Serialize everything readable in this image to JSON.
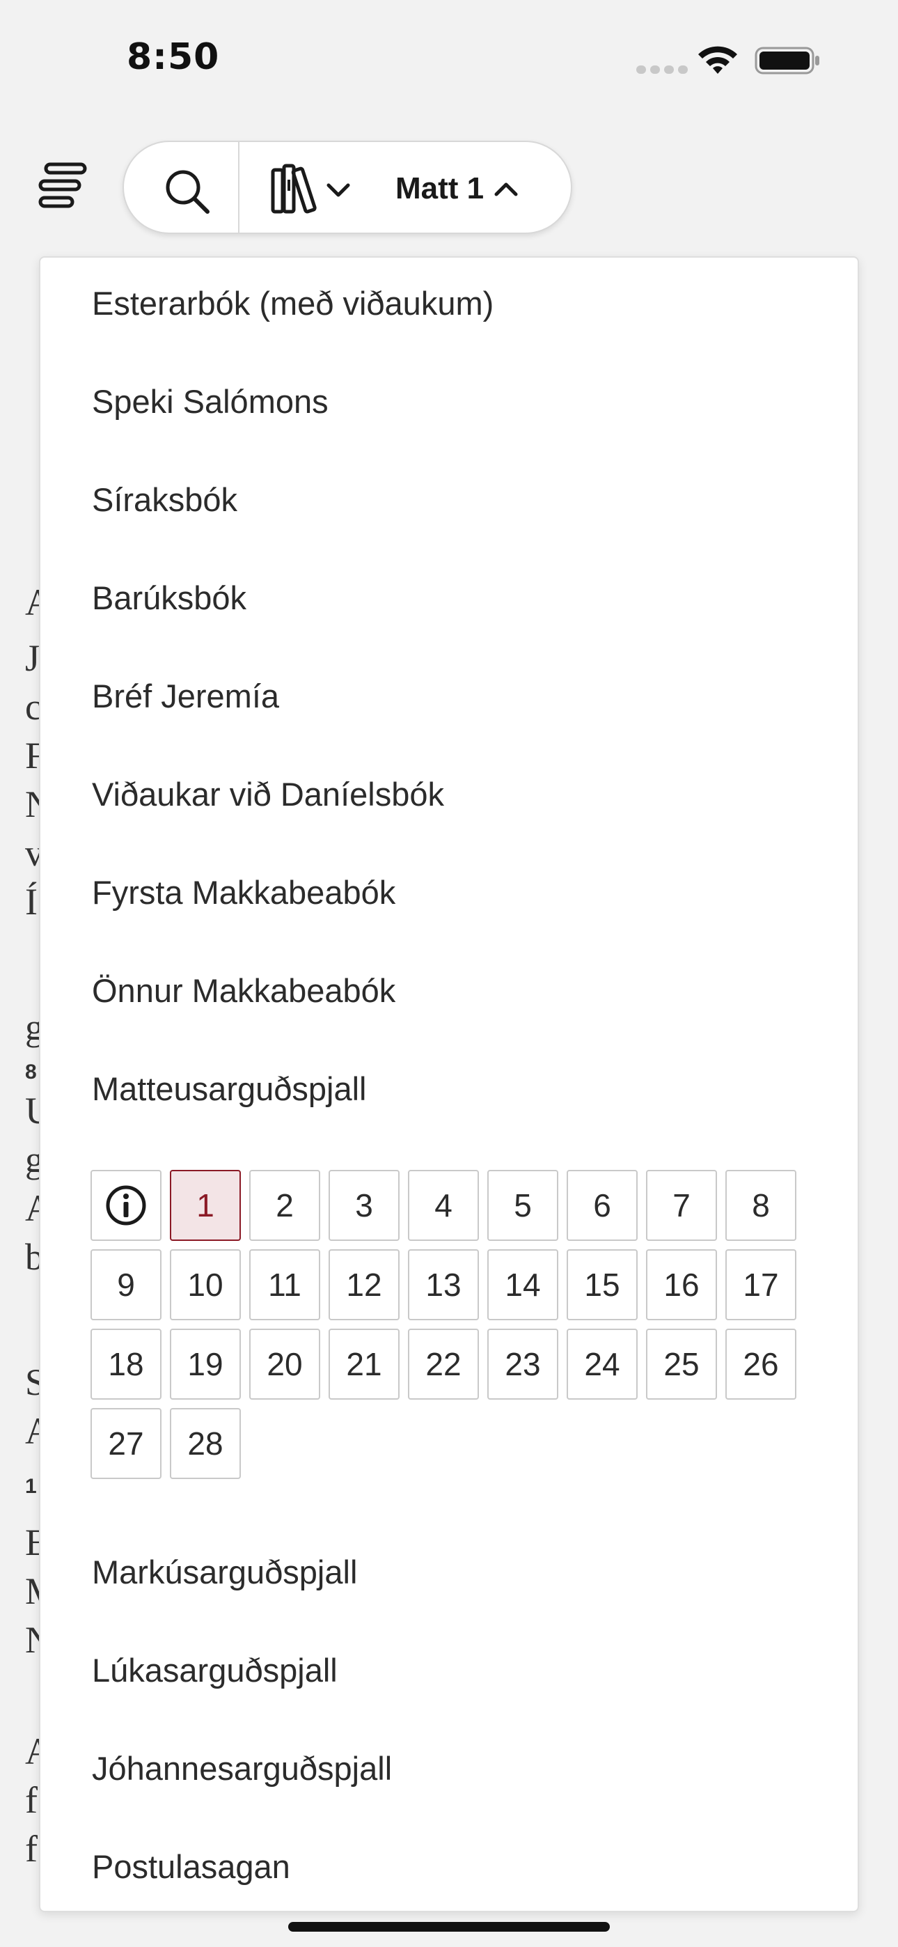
{
  "status_bar": {
    "time": "8:50"
  },
  "toolbar": {
    "chapter_label": "Matt 1",
    "menu_icon": "menu-lines-icon",
    "search_icon": "search-icon",
    "library_icon": "library-books-icon"
  },
  "dropdown": {
    "books_before": [
      "Esterarbók (með viðaukum)",
      "Speki Salómons",
      "Síraksbók",
      "Barúksbók",
      "Bréf Jeremía",
      "Viðaukar við Daníelsbók",
      "Fyrsta Makkabeabók",
      "Önnur Makkabeabók",
      "Matteusarguðspjall"
    ],
    "chapters": [
      "1",
      "2",
      "3",
      "4",
      "5",
      "6",
      "7",
      "8",
      "9",
      "10",
      "11",
      "12",
      "13",
      "14",
      "15",
      "16",
      "17",
      "18",
      "19",
      "20",
      "21",
      "22",
      "23",
      "24",
      "25",
      "26",
      "27",
      "28"
    ],
    "selected_chapter": "1",
    "books_after": [
      "Markúsarguðspjall",
      "Lúkasarguðspjall",
      "Jóhannesarguðspjall",
      "Postulasagan"
    ]
  },
  "background_letters": [
    "A",
    "J",
    "c",
    "F",
    "N",
    "v",
    "Í",
    "g",
    "8",
    "U",
    "g",
    "A",
    "b",
    "S",
    "A",
    "1",
    "E",
    "M",
    "N",
    "A",
    "f",
    "f"
  ],
  "colors": {
    "accent": "#8b1a26",
    "selected_bg": "#f3e4e6"
  }
}
